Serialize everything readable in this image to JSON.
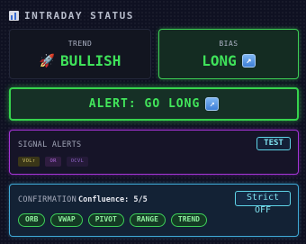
{
  "header": {
    "icon": "bar-chart-icon",
    "title": "INTRADAY STATUS"
  },
  "trend": {
    "label": "TREND",
    "icon": "rocket-icon",
    "icon_glyph": "🚀",
    "value": "BULLISH"
  },
  "bias": {
    "label": "BIAS",
    "value": "LONG",
    "icon": "arrow-up-right-icon",
    "icon_glyph": "↗"
  },
  "alert": {
    "text": "ALERT: GO LONG",
    "icon": "arrow-up-right-icon",
    "icon_glyph": "↗"
  },
  "signal_alerts": {
    "title": "SIGNAL ALERTS",
    "test_label": "TEST",
    "chips": [
      "VOL↑",
      "OR",
      "OCVL"
    ]
  },
  "confirmation": {
    "title": "CONFIRMATION",
    "confluence": "Confluence: 5/5",
    "strict_label": "Strict OFF",
    "pills": [
      "ORB",
      "VWAP",
      "PIVOT",
      "RANGE",
      "TREND"
    ]
  },
  "colors": {
    "background": "#0f1122",
    "bull_green": "#3fe25a",
    "signal_purple": "#a534d6",
    "confirm_cyan": "#3fa9d6"
  }
}
